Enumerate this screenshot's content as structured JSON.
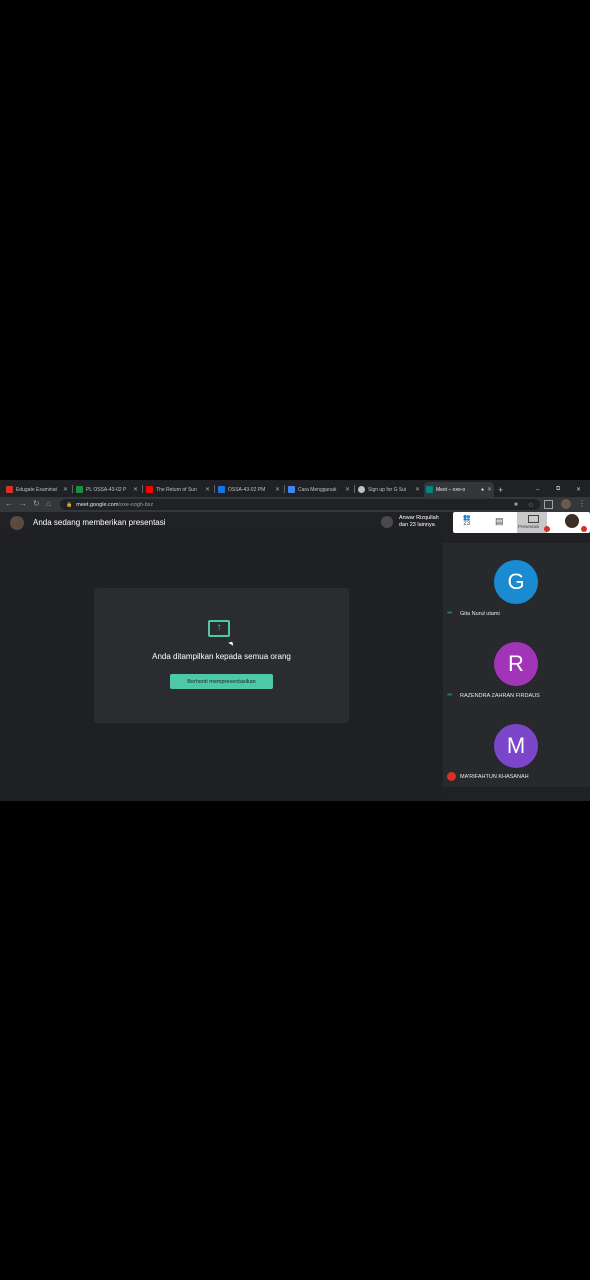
{
  "browser": {
    "tabs": [
      {
        "label": "Edugate Examinat",
        "icon": "mail-icon",
        "color": "#d93025"
      },
      {
        "label": "PL OSSA-43-02 P",
        "icon": "classroom-icon",
        "color": "#1e8e3e"
      },
      {
        "label": "The Return of Sun",
        "icon": "youtube-icon",
        "color": "#ff0000"
      },
      {
        "label": "OSSA-43-02 PM",
        "icon": "classroom-icon",
        "color": "#1a73e8"
      },
      {
        "label": "Cara Menggunak",
        "icon": "doc-icon",
        "color": "#4285f4"
      },
      {
        "label": "Sign up for G Sui",
        "icon": "google-icon",
        "color": "#bdc1c6"
      },
      {
        "label": "Meet – oxe-o",
        "icon": "meet-icon",
        "color": "#00897b"
      }
    ],
    "new_tab": "+",
    "url_host": "meet.google.com",
    "url_path": "/oxe-oogh-bxz"
  },
  "meet": {
    "presenting_text": "Anda sedang memberikan presentasi",
    "participants_name": "Anwar Rizqullah",
    "participants_more": "dan 23 lainnya",
    "participants_count": "23",
    "present_card_text": "Anda ditampilkan kepada semua orang",
    "stop_button": "Berhenti mempresentasikan",
    "toolbar_present_label": "Presentasi",
    "participants": [
      {
        "initial": "G",
        "name": "Gita Nurul utami",
        "color": "#1a8bd1",
        "mic": "speaking"
      },
      {
        "initial": "R",
        "name": "RAZENDRA ZAHRAN FIRDAUS",
        "color": "#a234b8",
        "mic": "speaking"
      },
      {
        "initial": "M",
        "name": "MA'RIFAHTUN KHASANAH",
        "color": "#7b46c9",
        "mic": "muted"
      }
    ]
  }
}
